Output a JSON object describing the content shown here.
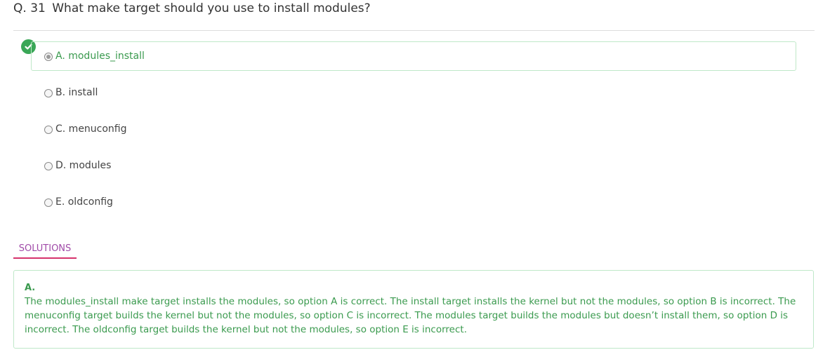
{
  "question": {
    "number": "Q. 31",
    "text": "What make target should you use to install modules?"
  },
  "options": [
    {
      "label": "A. modules_install",
      "selected": true,
      "correct": true
    },
    {
      "label": "B. install",
      "selected": false,
      "correct": false
    },
    {
      "label": "C. menuconfig",
      "selected": false,
      "correct": false
    },
    {
      "label": "D. modules",
      "selected": false,
      "correct": false
    },
    {
      "label": "E. oldconfig",
      "selected": false,
      "correct": false
    }
  ],
  "solutions": {
    "tab_label": "SOLUTIONS",
    "answer": "A.",
    "explanation": "The modules_install make target installs the modules, so option A is correct. The install target installs the kernel but not the modules, so option B is incorrect. The menuconfig target builds the kernel but not the modules, so option C is incorrect. The modules target builds the modules but doesn’t install them, so option D is incorrect. The oldconfig target builds the kernel but not the modules, so option E is incorrect."
  },
  "colors": {
    "correct_green": "#3aa757",
    "correct_text": "#3a9a4e",
    "tab_text": "#a04aa8",
    "tab_underline": "#d6336c"
  },
  "icons": {
    "correct_badge": "check-circle-icon"
  }
}
